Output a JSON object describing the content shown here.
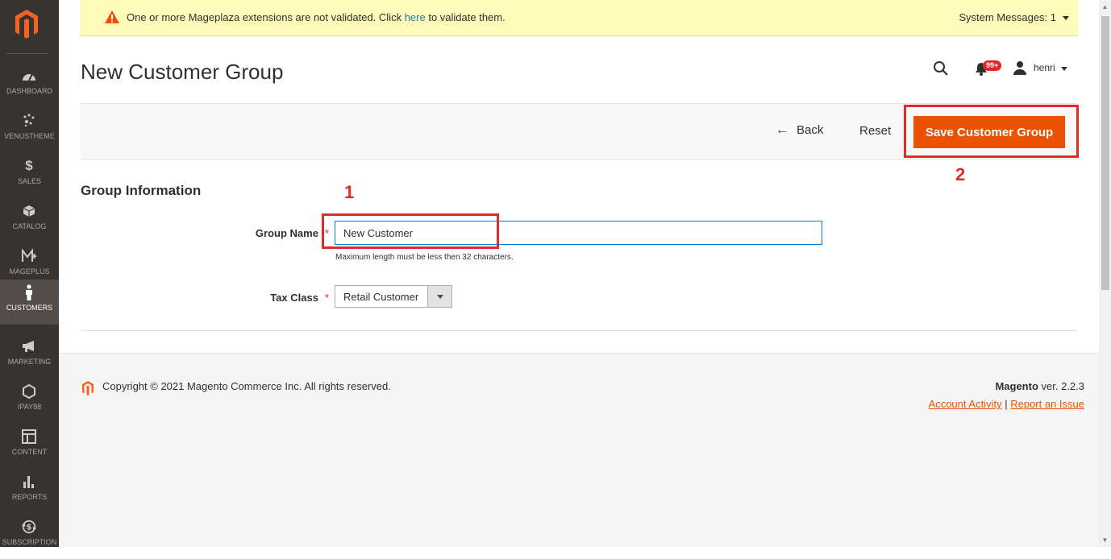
{
  "sidebar": {
    "logo_icon": "magento-logo-icon",
    "items": [
      {
        "label": "DASHBOARD",
        "icon": "dashboard-icon"
      },
      {
        "label": "VENUSTHEME",
        "icon": "venustheme-icon"
      },
      {
        "label": "SALES",
        "icon": "dollar-icon"
      },
      {
        "label": "CATALOG",
        "icon": "cube-icon"
      },
      {
        "label": "MAGEPLUS",
        "icon": "mageplus-icon"
      },
      {
        "label": "CUSTOMERS",
        "icon": "person-icon"
      },
      {
        "label": "MARKETING",
        "icon": "megaphone-icon"
      },
      {
        "label": "IPAY88",
        "icon": "hexagon-icon"
      },
      {
        "label": "CONTENT",
        "icon": "layout-icon"
      },
      {
        "label": "REPORTS",
        "icon": "bar-chart-icon"
      },
      {
        "label": "SUBSCRIPTION",
        "icon": "subscription-icon"
      }
    ],
    "active_item": "CUSTOMERS"
  },
  "message_bar": {
    "text_before": "One or more Mageplaza extensions are not validated. Click ",
    "link_text": "here",
    "text_after": " to validate them.",
    "system_messages": "System Messages: 1"
  },
  "header": {
    "title": "New Customer Group",
    "notification_count": "99+",
    "user_name": "henri"
  },
  "actions": {
    "back_label": "Back",
    "reset_label": "Reset",
    "save_label": "Save Customer Group"
  },
  "annotations": {
    "step1": "1",
    "step2": "2",
    "highlight_color": "#e02b27"
  },
  "form": {
    "section_title": "Group Information",
    "group_name_label": "Group Name",
    "group_name_value": "New Customer",
    "group_name_hint": "Maximum length must be less then 32 characters.",
    "tax_class_label": "Tax Class",
    "tax_class_value": "Retail Customer",
    "required_marker": "*"
  },
  "footer": {
    "copyright": "Copyright © 2021 Magento Commerce Inc. All rights reserved.",
    "brand": "Magento",
    "version": " ver. 2.2.3",
    "account_activity": "Account Activity",
    "separator": "|",
    "report_issue": "Report an Issue"
  },
  "colors": {
    "accent": "#eb5202",
    "sidebar_bg": "#373330",
    "message_bg": "#fffbbb",
    "link": "#1979c3"
  }
}
